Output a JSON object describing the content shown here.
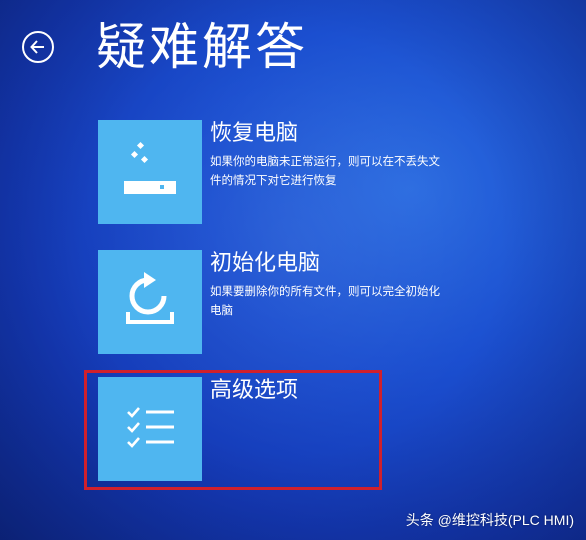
{
  "header": {
    "back_icon": "arrow-left-circle-icon",
    "title": "疑难解答"
  },
  "options": [
    {
      "icon": "restore-drive-icon",
      "title": "恢复电脑",
      "description": "如果你的电脑未正常运行，则可以在不丢失文件的情况下对它进行恢复"
    },
    {
      "icon": "refresh-drive-icon",
      "title": "初始化电脑",
      "description": "如果要删除你的所有文件，则可以完全初始化电脑"
    },
    {
      "icon": "checklist-icon",
      "title": "高级选项",
      "description": ""
    }
  ],
  "watermark": "头条 @维控科技(PLC HMI)",
  "colors": {
    "background": "#1b4fd0",
    "tile": "#4fb6f0",
    "text": "#ffffff",
    "highlight": "#d0202c"
  }
}
